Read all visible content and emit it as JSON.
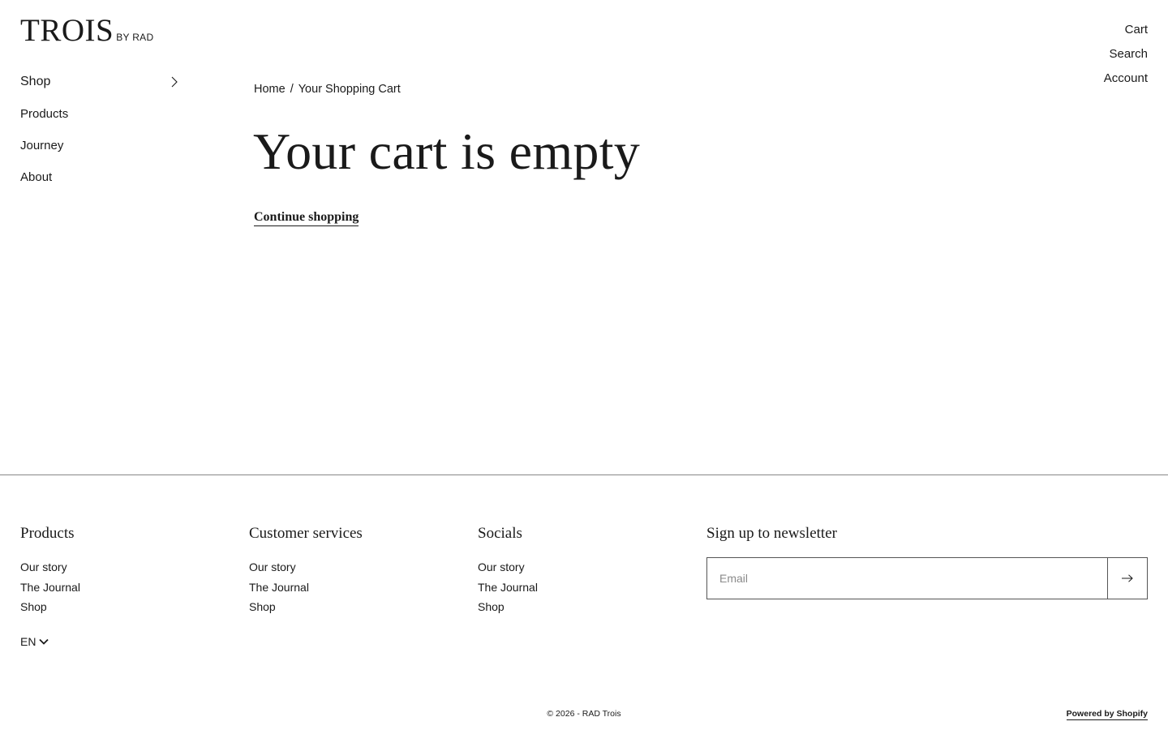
{
  "brand": {
    "name": "TROIS",
    "sub": "BY RAD"
  },
  "left_nav": [
    {
      "label": "Shop",
      "icon": "chevron-right-icon"
    },
    {
      "label": "Products"
    },
    {
      "label": "Journey"
    },
    {
      "label": "About"
    }
  ],
  "util_nav": {
    "cart": "Cart",
    "search": "Search",
    "account": "Account"
  },
  "breadcrumb": {
    "home": "Home",
    "separator": "/",
    "current": "Your Shopping Cart"
  },
  "main": {
    "title": "Your cart is empty",
    "continue_label": "Continue shopping"
  },
  "footer": {
    "columns": [
      {
        "heading": "Products",
        "links": [
          "Our story",
          "The Journal",
          "Shop"
        ]
      },
      {
        "heading": "Customer services",
        "links": [
          "Our story",
          "The Journal",
          "Shop"
        ]
      },
      {
        "heading": "Socials",
        "links": [
          "Our story",
          "The Journal",
          "Shop"
        ]
      }
    ],
    "newsletter": {
      "heading": "Sign up to newsletter",
      "placeholder": "Email",
      "submit_icon": "arrow-right-icon"
    },
    "language": {
      "value": "EN",
      "icon": "chevron-down-icon"
    },
    "copyright": "© 2026 - RAD Trois",
    "powered_by": "Powered by Shopify"
  }
}
